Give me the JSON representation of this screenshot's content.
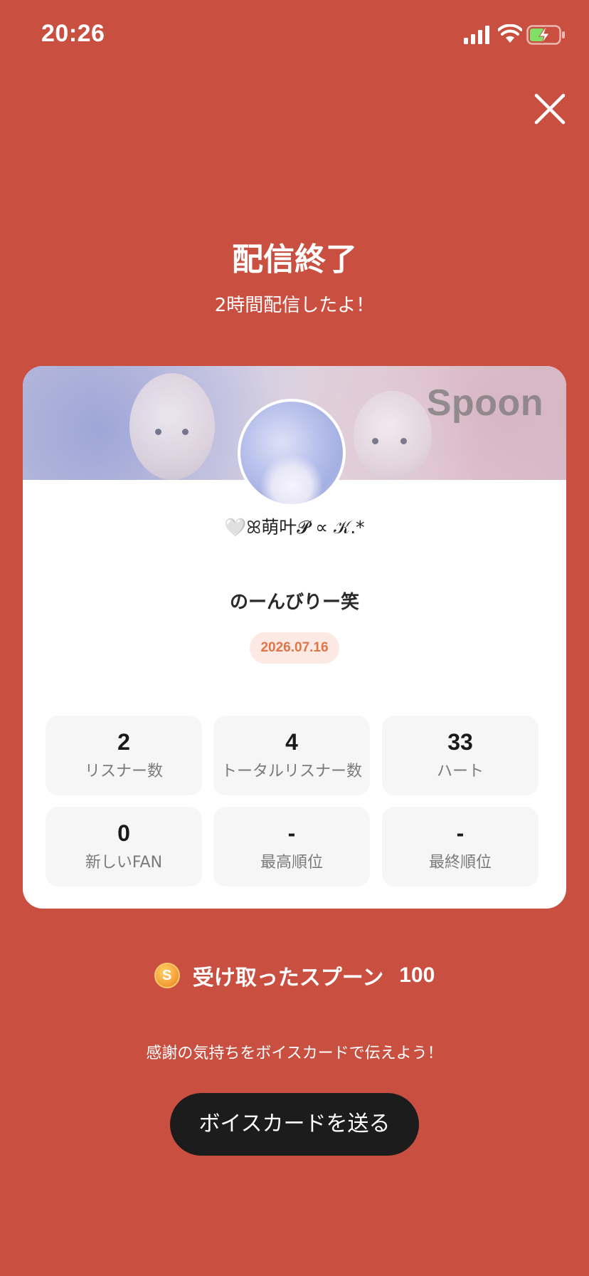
{
  "status_bar": {
    "time": "20:26"
  },
  "header": {
    "title": "配信終了",
    "subtitle": "2時間配信したよ！"
  },
  "card": {
    "banner_logo": "Spoon",
    "username": "🤍ꕤ萌叶𝓟 ∝ 𝒦.*",
    "stream_title": "のーんびりー笑",
    "date": "2026.07.16",
    "stats": [
      {
        "value": "2",
        "label": "リスナー数"
      },
      {
        "value": "4",
        "label": "トータルリスナー数"
      },
      {
        "value": "33",
        "label": "ハート"
      },
      {
        "value": "0",
        "label": "新しいFAN"
      },
      {
        "value": "-",
        "label": "最高順位"
      },
      {
        "value": "-",
        "label": "最終順位"
      }
    ]
  },
  "spoons": {
    "coin_symbol": "S",
    "label": "受け取ったスプーン",
    "count": "100"
  },
  "voice_card": {
    "prompt": "感謝の気持ちをボイスカードで伝えよう！",
    "button_label": "ボイスカードを送る"
  },
  "colors": {
    "background": "#c95040",
    "button": "#1c1c1c",
    "date_badge_bg": "#fde9e3",
    "date_badge_text": "#e07548"
  },
  "icons": [
    "signal-icon",
    "wifi-icon",
    "battery-charging-icon",
    "close-icon",
    "coin-icon"
  ]
}
